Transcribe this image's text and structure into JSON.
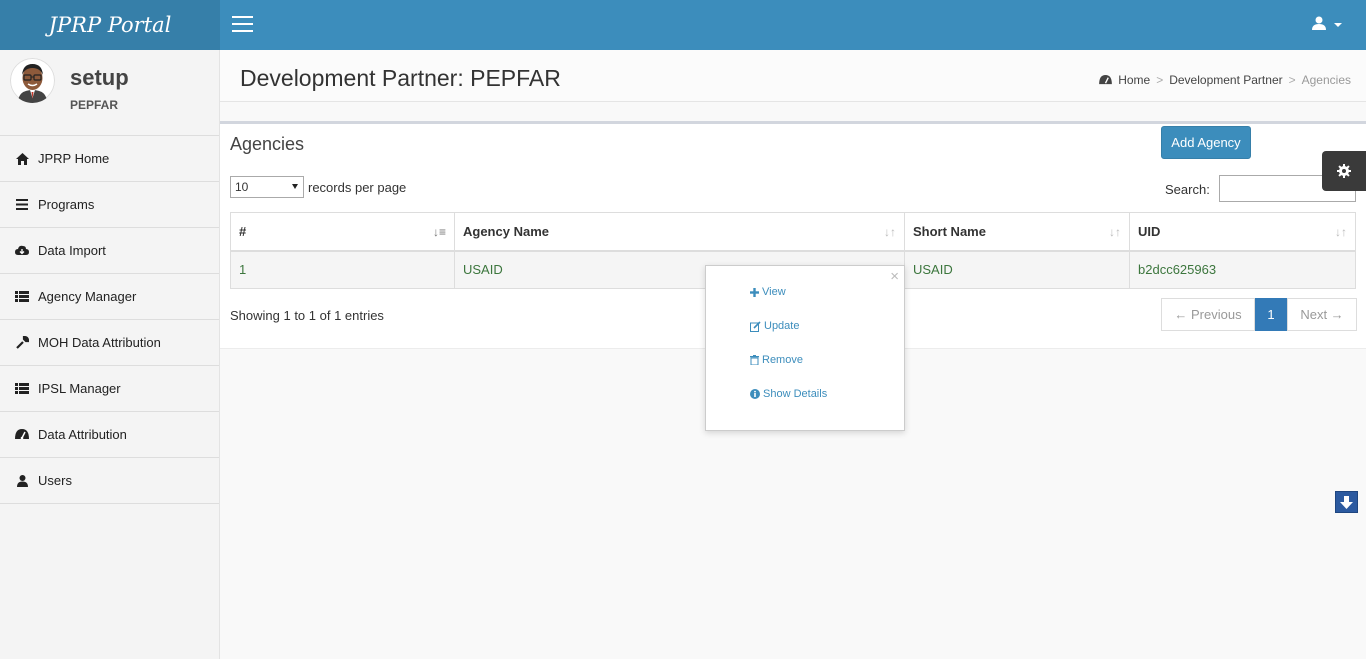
{
  "app": {
    "title": "JPRP Portal"
  },
  "user": {
    "name": "setup",
    "org": "PEPFAR"
  },
  "sidebar": {
    "items": [
      {
        "label": "JPRP Home",
        "icon": "home-icon"
      },
      {
        "label": "Programs",
        "icon": "bars-icon"
      },
      {
        "label": "Data Import",
        "icon": "cloud-download-icon"
      },
      {
        "label": "Agency Manager",
        "icon": "list-icon"
      },
      {
        "label": "MOH Data Attribution",
        "icon": "wrench-icon"
      },
      {
        "label": "IPSL Manager",
        "icon": "list-icon"
      },
      {
        "label": "Data Attribution",
        "icon": "dashboard-icon"
      },
      {
        "label": "Users",
        "icon": "user-icon"
      }
    ]
  },
  "header": {
    "title": "Development Partner: PEPFAR",
    "breadcrumb": {
      "home": "Home",
      "partner": "Development Partner",
      "current": "Agencies"
    }
  },
  "box": {
    "title": "Agencies",
    "add_label": "Add Agency",
    "length_value": "10",
    "length_label": "records per page",
    "search_label": "Search:",
    "info": "Showing 1 to 1 of 1 entries"
  },
  "table": {
    "headers": [
      "#",
      "Agency Name",
      "Short Name",
      "UID"
    ],
    "rows": [
      [
        "1",
        "USAID",
        "USAID",
        "b2dcc625963"
      ]
    ]
  },
  "pagination": {
    "prev": "← Previous",
    "current": "1",
    "next": "Next →"
  },
  "popover": {
    "close": "×",
    "actions": [
      {
        "label": "View",
        "icon": "plus-icon"
      },
      {
        "label": "Update",
        "icon": "edit-icon"
      },
      {
        "label": "Remove",
        "icon": "trash-icon"
      },
      {
        "label": "Show Details",
        "icon": "info-icon"
      }
    ]
  },
  "colors": {
    "topbar": "#3c8dbc",
    "logo": "#367fa9",
    "link": "#3c8dbc",
    "table_text": "#3c763d"
  }
}
